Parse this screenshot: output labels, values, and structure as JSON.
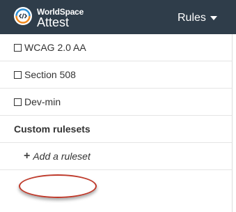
{
  "header": {
    "brand_small": "WorldSpace",
    "brand_large": "Attest",
    "rules_menu_label": "Rules"
  },
  "rulesets": [
    {
      "label": "WCAG 2.0 AA",
      "checked": false
    },
    {
      "label": "Section 508",
      "checked": false
    },
    {
      "label": "Dev-min",
      "checked": false
    }
  ],
  "custom": {
    "title": "Custom rulesets",
    "add_label": "Add a ruleset"
  },
  "colors": {
    "topbar": "#2f3d4a",
    "highlight": "#bf3a2b"
  }
}
